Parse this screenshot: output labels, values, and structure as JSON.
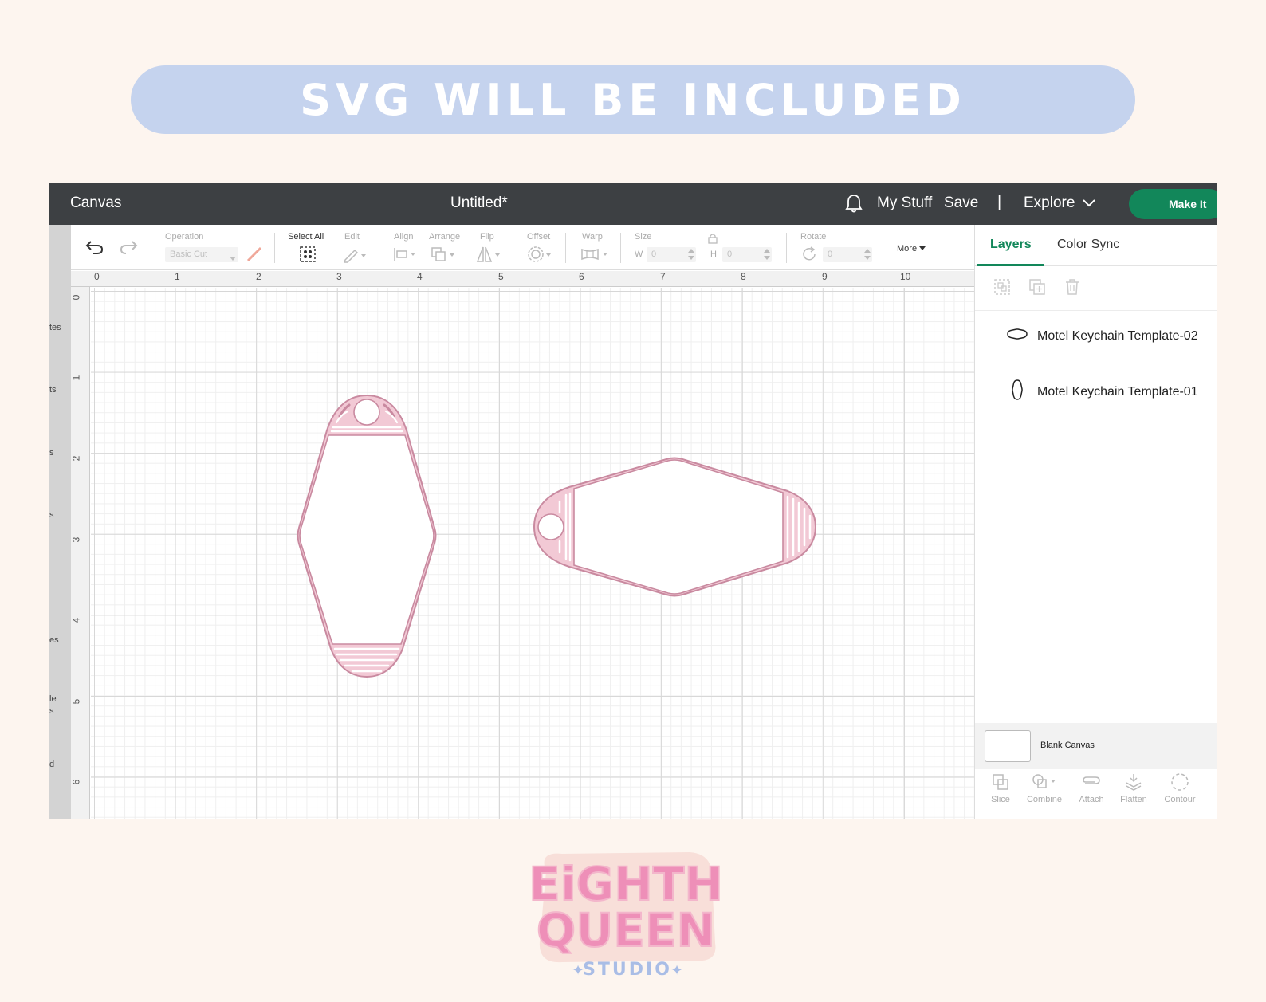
{
  "banner": {
    "text": "SVG WILL BE INCLUDED"
  },
  "topbar": {
    "title": "Canvas",
    "document": "Untitled*",
    "my_stuff": "My Stuff",
    "save": "Save",
    "separator": "|",
    "explore": "Explore",
    "make_it": "Make It"
  },
  "left_strip": {
    "labels": [
      "tes",
      "ts",
      "s",
      "s",
      "es",
      "le",
      "s",
      "d"
    ]
  },
  "toolbar": {
    "operation_label": "Operation",
    "operation_value": "Basic Cut",
    "select_all": "Select All",
    "edit": "Edit",
    "align": "Align",
    "arrange": "Arrange",
    "flip": "Flip",
    "offset": "Offset",
    "warp": "Warp",
    "size": "Size",
    "w_label": "W",
    "w_value": "0",
    "h_label": "H",
    "h_value": "0",
    "rotate": "Rotate",
    "rotate_value": "0",
    "more": "More"
  },
  "ruler": {
    "top": [
      "0",
      "1",
      "2",
      "3",
      "4",
      "5",
      "6",
      "7",
      "8",
      "9",
      "10"
    ],
    "left": [
      "0",
      "1",
      "2",
      "3",
      "4",
      "5",
      "6"
    ]
  },
  "panel": {
    "tabs": [
      "Layers",
      "Color Sync"
    ],
    "layers": [
      "Motel Keychain Template-02",
      "Motel Keychain Template-01"
    ],
    "blank_canvas": "Blank Canvas",
    "bottom_tools": [
      "Slice",
      "Combine",
      "Attach",
      "Flatten",
      "Contour"
    ]
  },
  "colors": {
    "shape_fill": "#f2c9d5",
    "shape_stroke": "#c98aa0",
    "accent": "#12875a",
    "banner": "#c5d3ee",
    "logo_pink": "#ee8fb8"
  },
  "logo": {
    "line1": "EiGHTH",
    "line2": "QUEEN",
    "line3": "STUDIO"
  }
}
